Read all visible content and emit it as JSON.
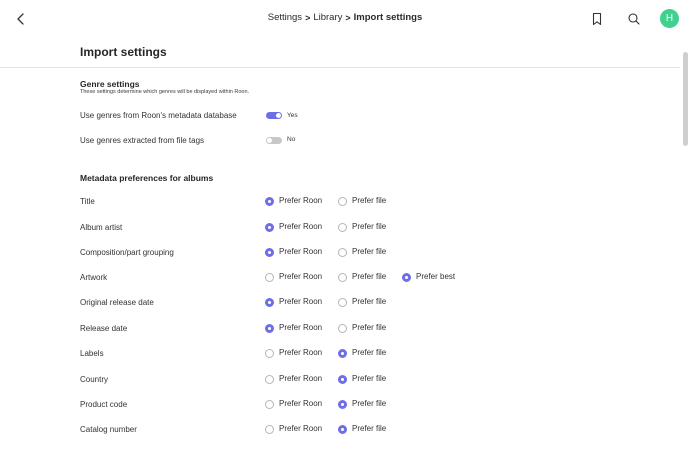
{
  "breadcrumb": {
    "items": [
      "Settings",
      "Library"
    ],
    "current": "Import settings",
    "separator": ">"
  },
  "user": {
    "avatar_letter": "H",
    "avatar_color": "#3fd28f"
  },
  "accent_color": "#6e6ee6",
  "page_title": "Import settings",
  "genre": {
    "title": "Genre settings",
    "description": "These settings determine which genres will be displayed within Roon.",
    "rows": [
      {
        "label": "Use genres from Roon's metadata database",
        "enabled": true,
        "state_text": "Yes"
      },
      {
        "label": "Use genres extracted from file tags",
        "enabled": false,
        "state_text": "No"
      }
    ]
  },
  "metadata": {
    "title": "Metadata preferences for albums",
    "option_labels": {
      "roon": "Prefer Roon",
      "file": "Prefer file",
      "best": "Prefer best"
    },
    "rows": [
      {
        "label": "Title",
        "selected": "roon",
        "has_best": false
      },
      {
        "label": "Album artist",
        "selected": "roon",
        "has_best": false
      },
      {
        "label": "Composition/part grouping",
        "selected": "roon",
        "has_best": false
      },
      {
        "label": "Artwork",
        "selected": "best",
        "has_best": true
      },
      {
        "label": "Original release date",
        "selected": "roon",
        "has_best": false
      },
      {
        "label": "Release date",
        "selected": "roon",
        "has_best": false
      },
      {
        "label": "Labels",
        "selected": "file",
        "has_best": false
      },
      {
        "label": "Country",
        "selected": "file",
        "has_best": false
      },
      {
        "label": "Product code",
        "selected": "file",
        "has_best": false
      },
      {
        "label": "Catalog number",
        "selected": "file",
        "has_best": false
      }
    ]
  },
  "icons": {
    "back": "chevron-left-icon",
    "bookmark": "bookmark-icon",
    "search": "search-icon"
  }
}
